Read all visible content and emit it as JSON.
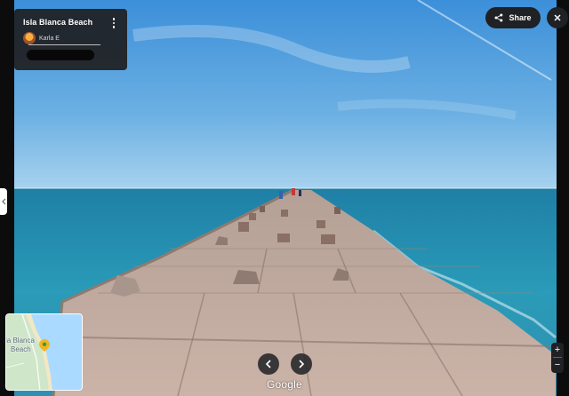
{
  "place": {
    "title": "Isla Blanca Beach",
    "author": "Karla E"
  },
  "actions": {
    "share_label": "Share"
  },
  "minimap": {
    "label_line1": "la Blanca",
    "label_line2": "Beach"
  },
  "branding": {
    "logo_text": "Google"
  },
  "zoom": {
    "in_label": "+",
    "out_label": "−"
  },
  "icons": {
    "more": "more-vert-icon",
    "share": "share-icon",
    "close": "close-icon",
    "prev": "chevron-left-icon",
    "next": "chevron-right-icon",
    "collapse": "chevron-left-icon",
    "pin": "map-pin-icon"
  },
  "colors": {
    "panel": "#202124",
    "sky": "#5aa7df",
    "sea": "#2a9bb8",
    "stone": "#c6aea3"
  }
}
